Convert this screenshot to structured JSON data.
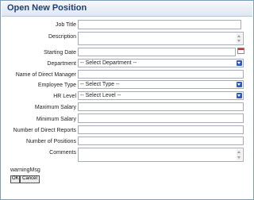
{
  "window": {
    "title": "Open New Position"
  },
  "form": {
    "job_title": {
      "label": "Job Title",
      "value": ""
    },
    "description": {
      "label": "Description",
      "value": ""
    },
    "starting_date": {
      "label": "Starting Date",
      "value": ""
    },
    "department": {
      "label": "Department",
      "selected": "-- Select Department --"
    },
    "direct_manager": {
      "label": "Name of Direct Manager",
      "value": ""
    },
    "employee_type": {
      "label": "Employee Type",
      "selected": "-- Select Type --"
    },
    "hr_level": {
      "label": "HR Level",
      "selected": "-- Select Level --"
    },
    "maximum_salary": {
      "label": "Maximum Salary",
      "value": ""
    },
    "minimum_salary": {
      "label": "Minimum Salary",
      "value": ""
    },
    "direct_reports": {
      "label": "Number of Direct Reports",
      "value": ""
    },
    "positions": {
      "label": "Number of Positions",
      "value": ""
    },
    "comments": {
      "label": "Comments",
      "value": ""
    }
  },
  "warning_msg": "warningMsg",
  "buttons": {
    "ok": "OK",
    "cancel": "Cancel"
  },
  "icons": {
    "calendar": "calendar-icon",
    "dropdown": "chevron-down-icon"
  }
}
